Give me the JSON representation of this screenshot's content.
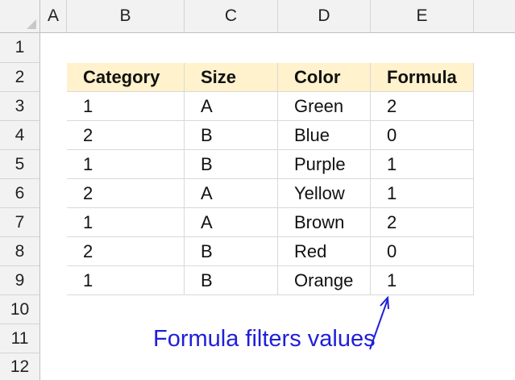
{
  "columns": [
    "A",
    "B",
    "C",
    "D",
    "E"
  ],
  "rows": [
    "1",
    "2",
    "3",
    "4",
    "5",
    "6",
    "7",
    "8",
    "9",
    "10",
    "11",
    "12"
  ],
  "table": {
    "headers": [
      "Category",
      "Size",
      "Color",
      "Formula"
    ],
    "rows": [
      [
        "1",
        "A",
        "Green",
        "2"
      ],
      [
        "2",
        "B",
        "Blue",
        "0"
      ],
      [
        "1",
        "B",
        "Purple",
        "1"
      ],
      [
        "2",
        "A",
        "Yellow",
        "1"
      ],
      [
        "1",
        "A",
        "Brown",
        "2"
      ],
      [
        "2",
        "B",
        "Red",
        "0"
      ],
      [
        "1",
        "B",
        "Orange",
        "1"
      ]
    ]
  },
  "annotation": {
    "text": "Formula filters values",
    "color": "#1f1fd8"
  },
  "colors": {
    "header_fill": "#fff2cc",
    "sheet_header_fill": "#f2f2f2"
  }
}
